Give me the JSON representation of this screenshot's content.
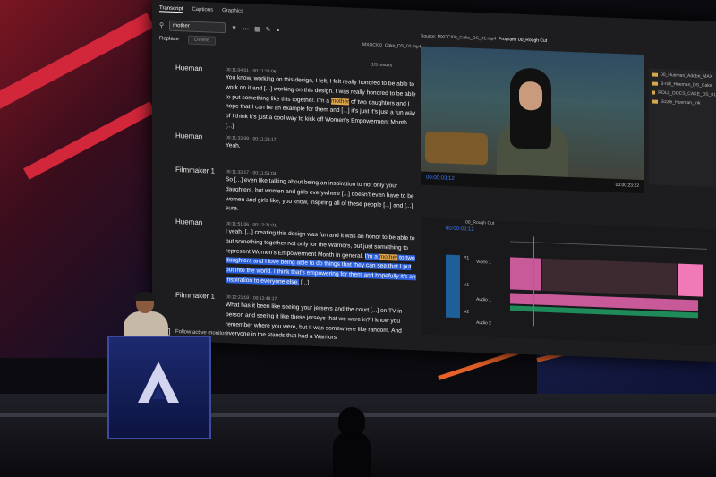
{
  "panel": {
    "tabs": [
      "Transcript",
      "Captions",
      "Graphics"
    ],
    "search_value": "mother",
    "replace_label": "Replace",
    "delete_label": "Delete",
    "filename": "MXOCI00_Cake_DS_02.mp4",
    "results": "1/3 results",
    "follow_label": "Follow active monitor"
  },
  "transcript": [
    {
      "speaker": "Hueman",
      "timecode": "00:11:04:01 - 00:11:33:06",
      "text_before": "You know, working on this design, I felt, I felt really honored to be able to work on it and [...] working on this design. I was really honored to be able to put something like this together. I'm a ",
      "highlight": "mother",
      "text_after": " of two daughters and I hope that I can be an example for them and [...] it's just it's just a fun way of I think it's just a cool way to kick off Women's Empowerment Month. [...]"
    },
    {
      "speaker": "Hueman",
      "timecode": "00:11:33:08 - 00:11:33:17",
      "text": "Yeah."
    },
    {
      "speaker": "Filmmaker 1",
      "timecode": "00:11:33:17 - 00:11:51:04",
      "text": "So [...] even like talking about being an inspiration to not only your daughters, but women and girls everywhere [...] doesn't even have to be women and girls like, you know, inspiring all of these people [...] and [...] sure."
    },
    {
      "speaker": "Hueman",
      "timecode": "00:11:51:06 - 00:12:21:01",
      "text_before": "I yeah, [...] creating this design was fun and it was an honor to be able to put something together not only for the Warriors, but just something to represent Women's Empowerment Month in general. ",
      "selected_before": "I'm a ",
      "highlight": "mother",
      "selected_after": " to two daughters and I love being able to do things that they can see that I put out into the world. I think that's empowering for them and hopefully it's an inspiration to everyone else.",
      "text_after": " [...]"
    },
    {
      "speaker": "Filmmaker 1",
      "timecode": "00:12:21:03 - 00:12:48:17",
      "text": "What has it been like seeing your jerseys and the court [...] on TV in person and seeing it like these jerseys that we were in? I know you remember where you were, but it was somewhere like random. And everyone in the stands that had a Warriors"
    }
  ],
  "monitor": {
    "source_tab": "Source: MXOCI00_Cake_DS_01.mp4",
    "program_tab": "Program: 00_Rough Cut",
    "timecode": "00:00:03:12",
    "duration": "00:00:23:22"
  },
  "timeline": {
    "name": "00_Rough Cut",
    "timecode": "00:00:03:12",
    "tracks": [
      "V1",
      "A1",
      "A2"
    ],
    "clip_labels": [
      "Video 1",
      "Audio 1",
      "Audio 2"
    ]
  },
  "project": {
    "items": [
      "00_Hueman_Adobe_MAX",
      "B-roll_Hueman_DS_Cake",
      "ROLL_DOCS_CAKE_DS_01",
      "Sizzle_Hueman_Ink"
    ]
  },
  "colors": {
    "selection": "#2b5fd9",
    "highlight": "#e0a64a",
    "timecode": "#3e7bff",
    "brand": "#d2263a"
  }
}
